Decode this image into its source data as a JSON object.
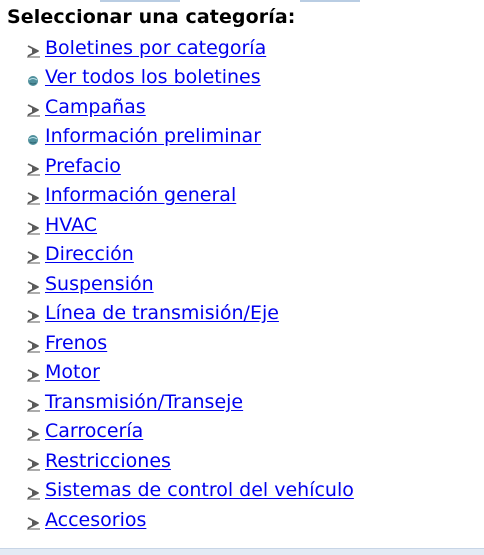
{
  "heading": "Seleccionar una categoría:",
  "categories": [
    {
      "label": "Boletines por categoría",
      "icon": "expand-arrow-icon"
    },
    {
      "label": "Ver todos los boletines",
      "icon": "globe-bullet-icon"
    },
    {
      "label": "Campañas",
      "icon": "expand-arrow-icon"
    },
    {
      "label": "Información preliminar",
      "icon": "globe-bullet-icon"
    },
    {
      "label": "Prefacio",
      "icon": "expand-arrow-icon"
    },
    {
      "label": "Información general",
      "icon": "expand-arrow-icon"
    },
    {
      "label": "HVAC",
      "icon": "expand-arrow-icon"
    },
    {
      "label": "Dirección",
      "icon": "expand-arrow-icon"
    },
    {
      "label": "Suspensión",
      "icon": "expand-arrow-icon"
    },
    {
      "label": "Línea de transmisión/Eje",
      "icon": "expand-arrow-icon"
    },
    {
      "label": "Frenos",
      "icon": "expand-arrow-icon"
    },
    {
      "label": "Motor",
      "icon": "expand-arrow-icon"
    },
    {
      "label": "Transmisión/Transeje",
      "icon": "expand-arrow-icon"
    },
    {
      "label": "Carrocería",
      "icon": "expand-arrow-icon"
    },
    {
      "label": "Restricciones",
      "icon": "expand-arrow-icon"
    },
    {
      "label": "Sistemas de control del vehículo",
      "icon": "expand-arrow-icon"
    },
    {
      "label": "Accesorios",
      "icon": "expand-arrow-icon"
    }
  ],
  "colors": {
    "link": "#0000ee",
    "arrow_icon": "#5a5a5a",
    "globe_icon": "#4f8f9c",
    "heading": "#000000"
  }
}
